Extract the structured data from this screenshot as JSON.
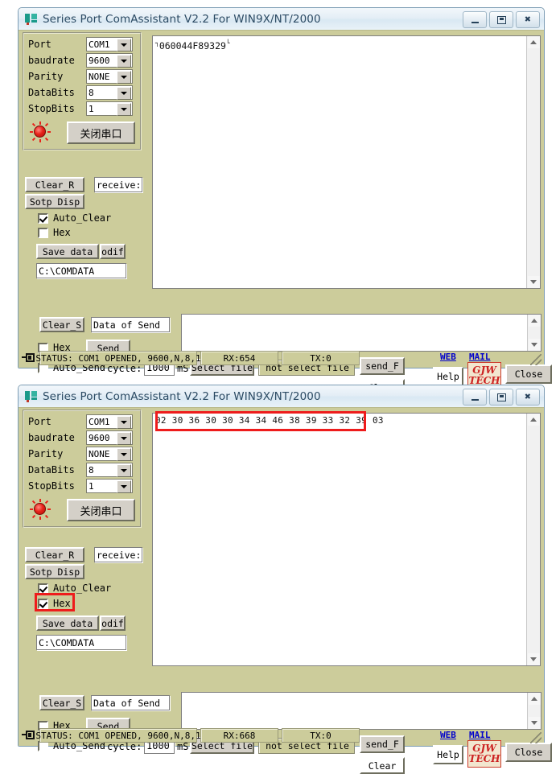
{
  "app": {
    "title": "Series Port ComAssistant V2.2 For WIN9X/NT/2000",
    "icon": "serial-port-app-icon",
    "bg_color": "#cccc9b",
    "titlebar_buttons": {
      "minimize": "minimize-icon",
      "maximize": "maximize-icon",
      "close": "close-icon"
    }
  },
  "settings": {
    "port_label": "Port",
    "port_value": "COM1",
    "baudrate_label": "baudrate",
    "baudrate_value": "9600",
    "parity_label": "Parity",
    "parity_value": "NONE",
    "databits_label": "DataBits",
    "databits_value": "8",
    "stopbits_label": "StopBits",
    "stopbits_value": "1",
    "open_close_button": "关闭串口",
    "led": "red-led-indicator"
  },
  "receive_panel": {
    "clear_button": "Clear_R",
    "receive_label": "receive:",
    "stop_disp_button": "Sotp Disp",
    "auto_clear_label": "Auto_Clear",
    "auto_clear_checked": true,
    "hex_label": "Hex",
    "save_data_button": "Save data",
    "modify_button": "odif",
    "path_value": "C:\\COMDATA"
  },
  "send_panel": {
    "clear_s_button": "Clear_S",
    "data_of_send_label": "Data of Send",
    "hex_label": "Hex",
    "hex_checked": false,
    "send_button": "Send",
    "auto_send_label": "Auto_Send",
    "auto_send_checked": false,
    "cycle_label": "cycle:",
    "cycle_value": "1000",
    "ms_label": "mS",
    "select_file_button": "Select file",
    "selected_file_value": "not select file",
    "send_f_button": "send_F",
    "send_text_value": ""
  },
  "footer": {
    "web_link": "WEB",
    "mail_link": "MAIL",
    "help_button": "Help",
    "close_button": "Close",
    "clear_button": "Clear",
    "logo_line1": "GJW",
    "logo_line2": "TECH",
    "logo_color": "#cc2222"
  },
  "window1": {
    "received_text_prefix": "┐",
    "received_text": "060044F89329",
    "received_text_suffix": "└",
    "hex_checked": false,
    "status": "STATUS: COM1 OPENED, 9600,N,8,1",
    "rx": "RX:654",
    "tx": "TX:0"
  },
  "window2": {
    "received_text": "02 30 36 30 30 34 34 46 38 39 33 32 39 03",
    "hex_checked": true,
    "status": "STATUS: COM1 OPENED, 9600,N,8,1",
    "rx": "RX:668",
    "tx": "TX:0",
    "annotation_color": "#ee1c1c",
    "annotations": [
      "receive-hex-data-highlight",
      "hex-checkbox-highlight"
    ]
  }
}
